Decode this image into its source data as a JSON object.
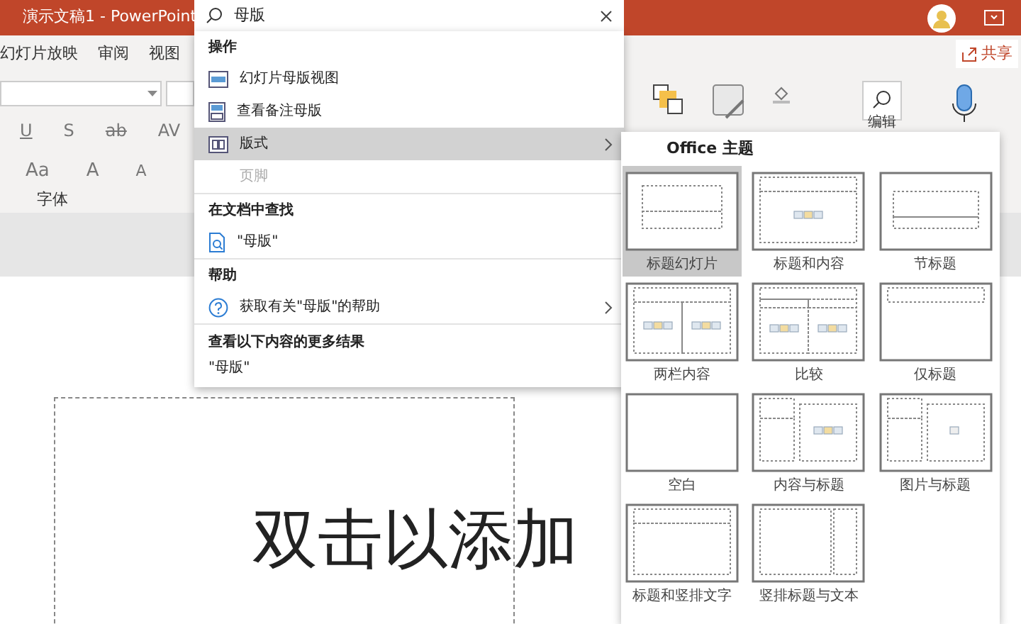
{
  "window": {
    "title": "演示文稿1 - PowerPoint"
  },
  "search": {
    "value": "母版"
  },
  "ribbon_tabs": [
    {
      "label": "幻灯片放映",
      "selected": false
    },
    {
      "label": "审阅",
      "selected": false
    },
    {
      "label": "视图",
      "selected": false
    }
  ],
  "share_button": {
    "label": "共享"
  },
  "font_group": {
    "label": "字体",
    "row_1": [
      {
        "glyph": "U",
        "kind": "underline"
      },
      {
        "glyph": "S",
        "kind": "shadow"
      },
      {
        "glyph": "ab",
        "kind": "strike"
      },
      {
        "glyph": "AV",
        "kind": "spacing"
      }
    ],
    "row_2": [
      {
        "glyph": "Aa",
        "kind": "case"
      },
      {
        "glyph": "A",
        "kind": "grow"
      },
      {
        "glyph": "A",
        "kind": "shrink"
      }
    ]
  },
  "edit_group": {
    "label": "编辑"
  },
  "slide": {
    "title_placeholder": "双击以添加"
  },
  "search_menu": {
    "sections": [
      {
        "heading": "操作",
        "items": [
          {
            "kind": "slide-master",
            "label": "幻灯片母版视图",
            "selected": false,
            "disabled": false,
            "submenu": false
          },
          {
            "kind": "notes-master",
            "label": "查看备注母版",
            "selected": false,
            "disabled": false,
            "submenu": false
          },
          {
            "kind": "layout",
            "label": "版式",
            "selected": true,
            "disabled": false,
            "submenu": true
          },
          {
            "kind": "none",
            "label": "页脚",
            "selected": false,
            "disabled": true,
            "submenu": false
          }
        ]
      },
      {
        "heading": "在文档中查找",
        "items": [
          {
            "kind": "find",
            "label": "\"母版\"",
            "selected": false,
            "disabled": false,
            "submenu": false
          }
        ]
      },
      {
        "heading": "帮助",
        "items": [
          {
            "kind": "help",
            "label": "获取有关\"母版\"的帮助",
            "selected": false,
            "disabled": false,
            "submenu": true
          }
        ]
      }
    ],
    "more_results": {
      "heading": "查看以下内容的更多结果",
      "query": "\"母版\""
    }
  },
  "layout_gallery": {
    "heading": "Office 主题",
    "layouts": [
      {
        "kind": "title",
        "label": "标题幻灯片",
        "selected": true
      },
      {
        "kind": "title-content",
        "label": "标题和内容",
        "selected": false
      },
      {
        "kind": "section",
        "label": "节标题",
        "selected": false
      },
      {
        "kind": "two-content",
        "label": "两栏内容",
        "selected": false
      },
      {
        "kind": "compare",
        "label": "比较",
        "selected": false
      },
      {
        "kind": "title-only",
        "label": "仅标题",
        "selected": false
      },
      {
        "kind": "blank",
        "label": "空白",
        "selected": false
      },
      {
        "kind": "content-caption",
        "label": "内容与标题",
        "selected": false
      },
      {
        "kind": "picture-caption",
        "label": "图片与标题",
        "selected": false
      },
      {
        "kind": "title-vertical",
        "label": "标题和竖排文字",
        "selected": false
      },
      {
        "kind": "vertical-title",
        "label": "竖排标题与文本",
        "selected": false
      }
    ]
  }
}
